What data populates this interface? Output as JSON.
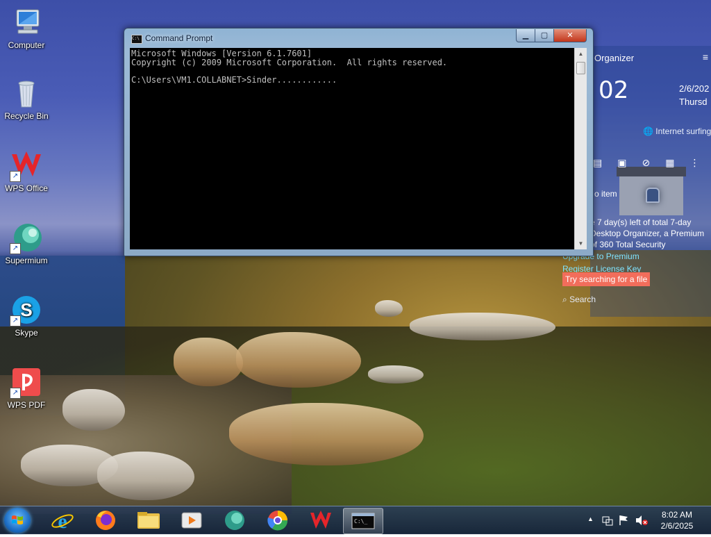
{
  "desktop_icons": [
    {
      "label": "Computer",
      "icon": "computer-icon"
    },
    {
      "label": "Recycle Bin",
      "icon": "recycle-bin-icon"
    },
    {
      "label": "WPS Office",
      "icon": "wps-office-icon"
    },
    {
      "label": "Supermium",
      "icon": "supermium-icon"
    },
    {
      "label": "Skype",
      "icon": "skype-icon"
    },
    {
      "label": "WPS PDF",
      "icon": "wps-pdf-icon"
    }
  ],
  "organizer": {
    "title": "Organizer",
    "clock": "02",
    "date_line1": "2/6/202",
    "date_line2": "Thursd",
    "internet_surfing": "Internet surfing",
    "no_item": "o item",
    "notice_line1": "e 7 day(s) left of total 7-day",
    "notice_line2": "Desktop Organizer, a Premium",
    "notice_line3": "of 360 Total Security",
    "upgrade_link": "Upgrade to Premium",
    "register_link": "Register License Key",
    "tooltip": "Try searching for a file",
    "search_label": "Search"
  },
  "cmd": {
    "title": "Command Prompt",
    "line1": "Microsoft Windows [Version 6.1.7601]",
    "line2": "Copyright (c) 2009 Microsoft Corporation.  All rights reserved.",
    "line3": "",
    "line4": "C:\\Users\\VM1.COLLABNET>Sinder............"
  },
  "taskbar": {
    "items": [
      "internet-explorer-icon",
      "firefox-icon",
      "file-explorer-icon",
      "media-player-icon",
      "supermium-icon",
      "chrome-like-icon",
      "wps-office-icon",
      "command-prompt-icon"
    ],
    "time": "8:02 AM",
    "date": "2/6/2025"
  }
}
